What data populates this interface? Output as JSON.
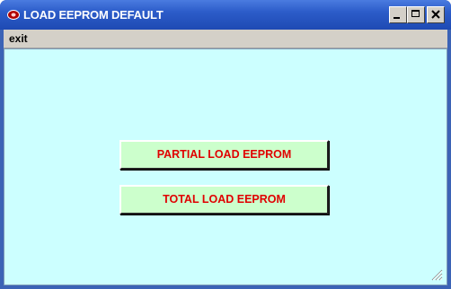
{
  "window": {
    "title": "LOAD EEPROM DEFAULT",
    "icon": "app-icon"
  },
  "menu": {
    "items": [
      {
        "label": "exit"
      }
    ]
  },
  "buttons": {
    "partial_label": "PARTIAL LOAD EEPROM",
    "total_label": "TOTAL LOAD EEPROM"
  },
  "colors": {
    "title_bar": "#2c5cc9",
    "client_background": "#ccffff",
    "button_background": "#ccffcc",
    "button_text": "#e00000"
  }
}
